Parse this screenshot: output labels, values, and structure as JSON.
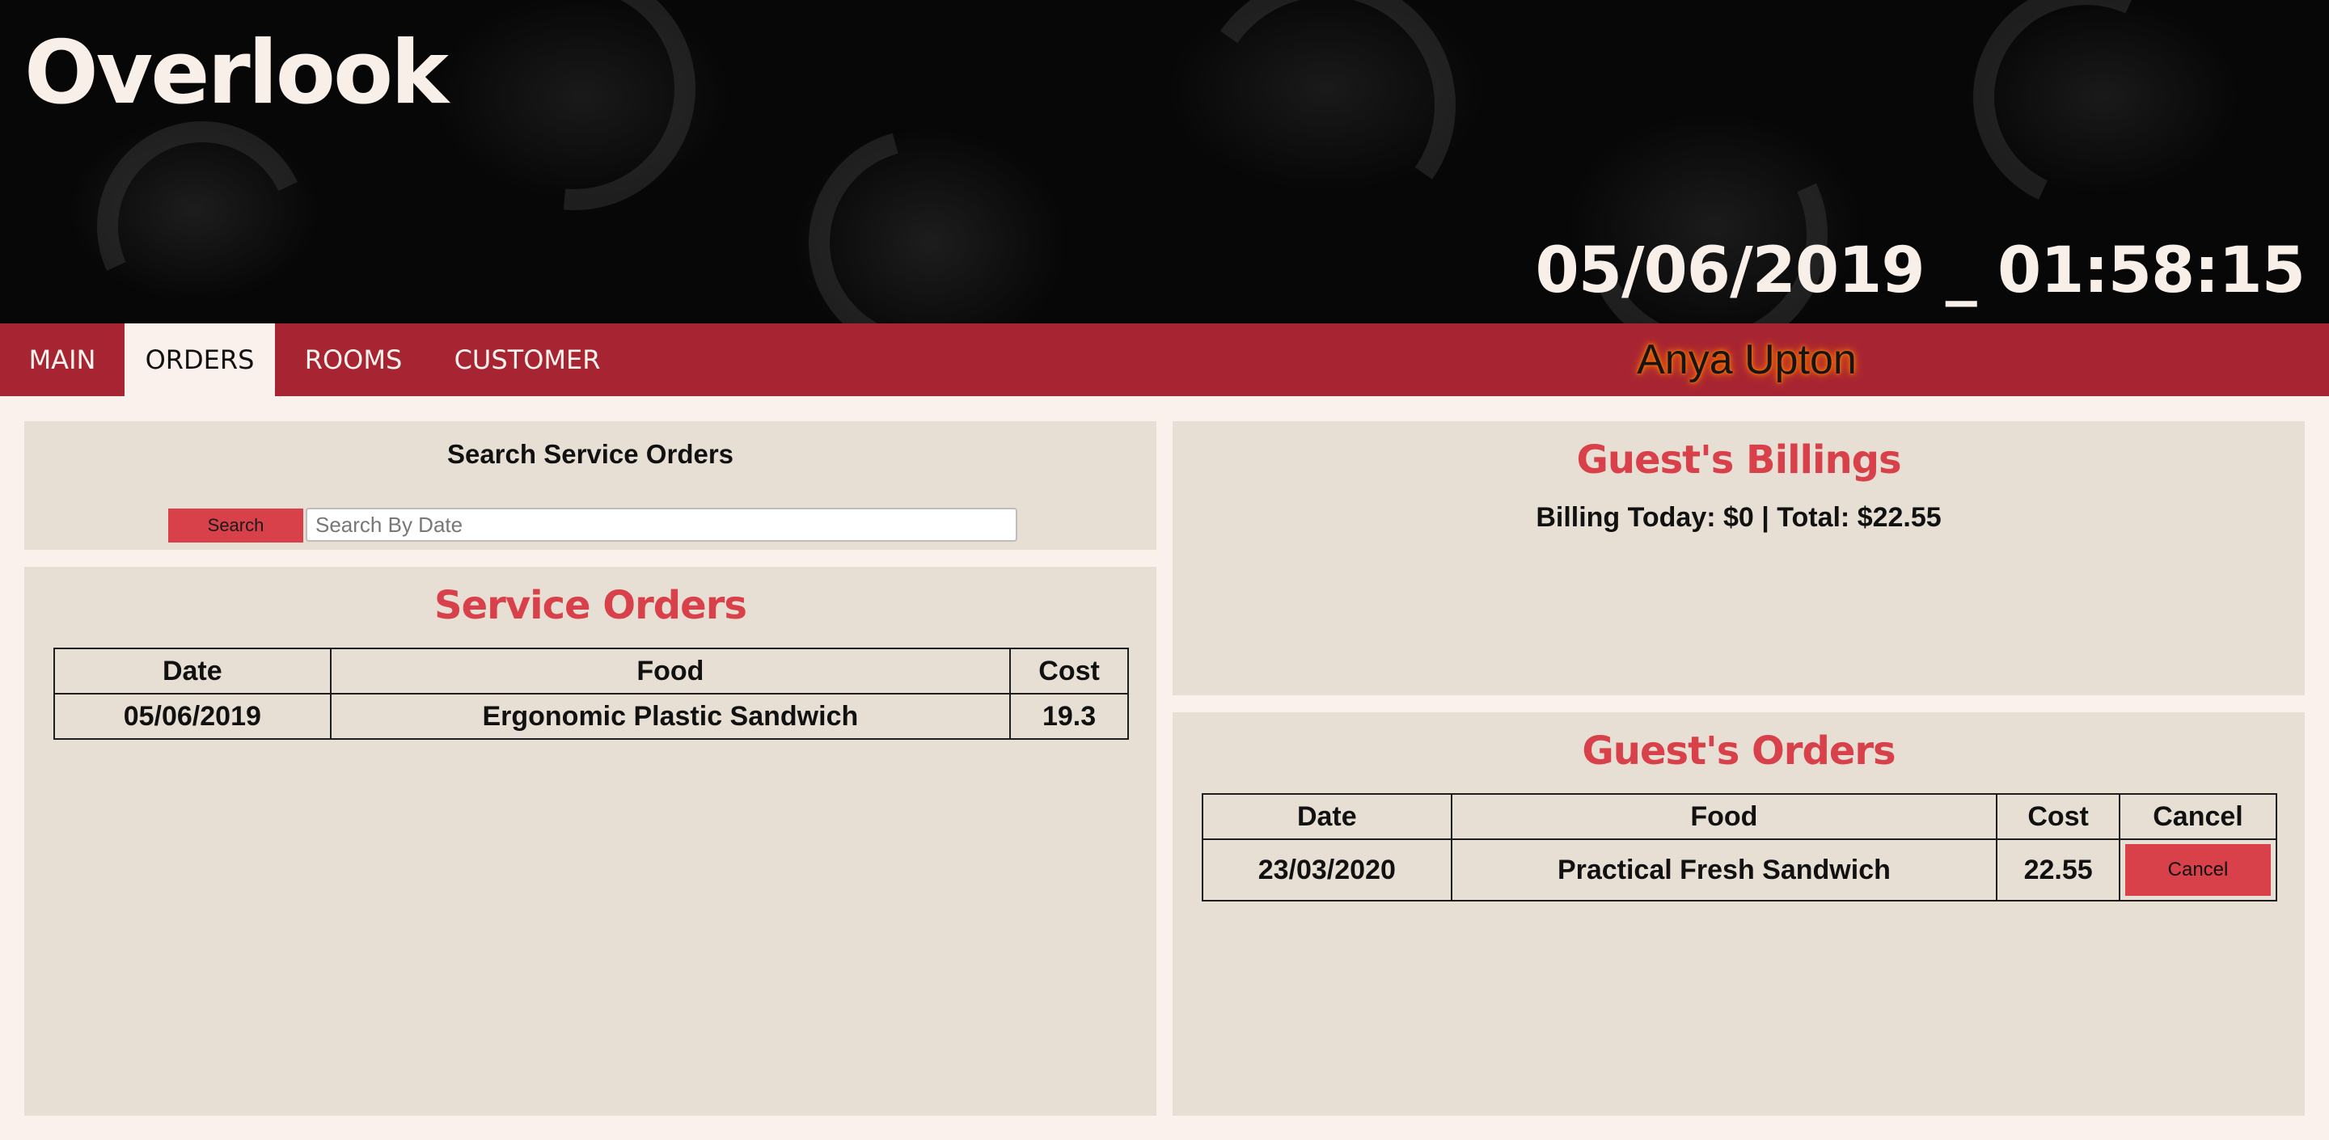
{
  "app": {
    "title": "Overlook",
    "datetime": "05/06/2019 _ 01:58:15",
    "current_user": "Anya Upton"
  },
  "nav": {
    "tabs": [
      {
        "label": "MAIN",
        "active": false
      },
      {
        "label": "ORDERS",
        "active": true
      },
      {
        "label": "ROOMS",
        "active": false
      },
      {
        "label": "CUSTOMER",
        "active": false
      }
    ]
  },
  "search": {
    "heading": "Search Service Orders",
    "button_label": "Search",
    "placeholder": "Search By Date",
    "value": ""
  },
  "service_orders": {
    "title": "Service Orders",
    "columns": [
      "Date",
      "Food",
      "Cost"
    ],
    "rows": [
      {
        "date": "05/06/2019",
        "food": "Ergonomic Plastic Sandwich",
        "cost": "19.3"
      }
    ]
  },
  "billings": {
    "title": "Guest's Billings",
    "summary": "Billing Today: $0 | Total: $22.55"
  },
  "guest_orders": {
    "title": "Guest's Orders",
    "columns": [
      "Date",
      "Food",
      "Cost",
      "Cancel"
    ],
    "rows": [
      {
        "date": "23/03/2020",
        "food": "Practical Fresh Sandwich",
        "cost": "22.55",
        "cancel_label": "Cancel"
      }
    ]
  },
  "colors": {
    "accent_red": "#d8404a",
    "nav_bg": "#a72532",
    "panel_bg": "#e8dfd4",
    "page_bg": "#faf1ec",
    "header_bg": "#070707"
  }
}
